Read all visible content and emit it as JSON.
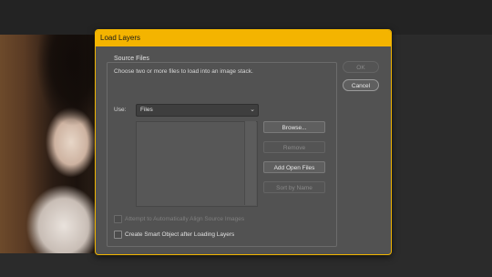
{
  "dialog": {
    "title": "Load Layers",
    "group_label": "Source Files",
    "description": "Choose two or more files to load into an image stack.",
    "use_label": "Use:",
    "use_value": "Files",
    "buttons": {
      "browse": "Browse...",
      "remove": "Remove",
      "add_open_files": "Add Open Files",
      "sort_by_name": "Sort by Name",
      "ok": "OK",
      "cancel": "Cancel"
    },
    "checkboxes": {
      "auto_align": "Attempt to Automatically Align Source Images",
      "smart_object": "Create Smart Object after Loading Layers"
    }
  },
  "colors": {
    "title_bar": "#f4b400",
    "dialog_bg": "#525252",
    "canvas_bg": "#2b2b2b"
  }
}
